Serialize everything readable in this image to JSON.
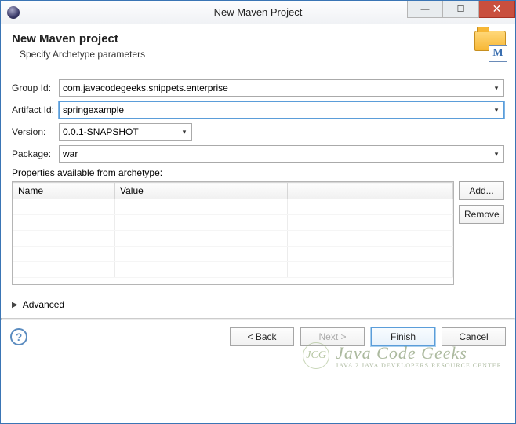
{
  "window": {
    "title": "New Maven Project"
  },
  "banner": {
    "heading": "New Maven project",
    "subtitle": "Specify Archetype parameters",
    "mIcon": "M"
  },
  "form": {
    "groupId": {
      "label": "Group Id:",
      "value": "com.javacodegeeks.snippets.enterprise"
    },
    "artifactId": {
      "label": "Artifact Id:",
      "value": "springexample"
    },
    "version": {
      "label": "Version:",
      "value": "0.0.1-SNAPSHOT"
    },
    "package": {
      "label": "Package:",
      "value": "war"
    }
  },
  "properties": {
    "label": "Properties available from archetype:",
    "columns": {
      "name": "Name",
      "value": "Value"
    },
    "buttons": {
      "add": "Add...",
      "remove": "Remove"
    }
  },
  "advanced": {
    "label": "Advanced"
  },
  "watermark": {
    "jcg": "JCG",
    "big": "Java Code Geeks",
    "small": "JAVA 2 JAVA DEVELOPERS RESOURCE CENTER"
  },
  "footer": {
    "back": "< Back",
    "next": "Next >",
    "finish": "Finish",
    "cancel": "Cancel"
  }
}
